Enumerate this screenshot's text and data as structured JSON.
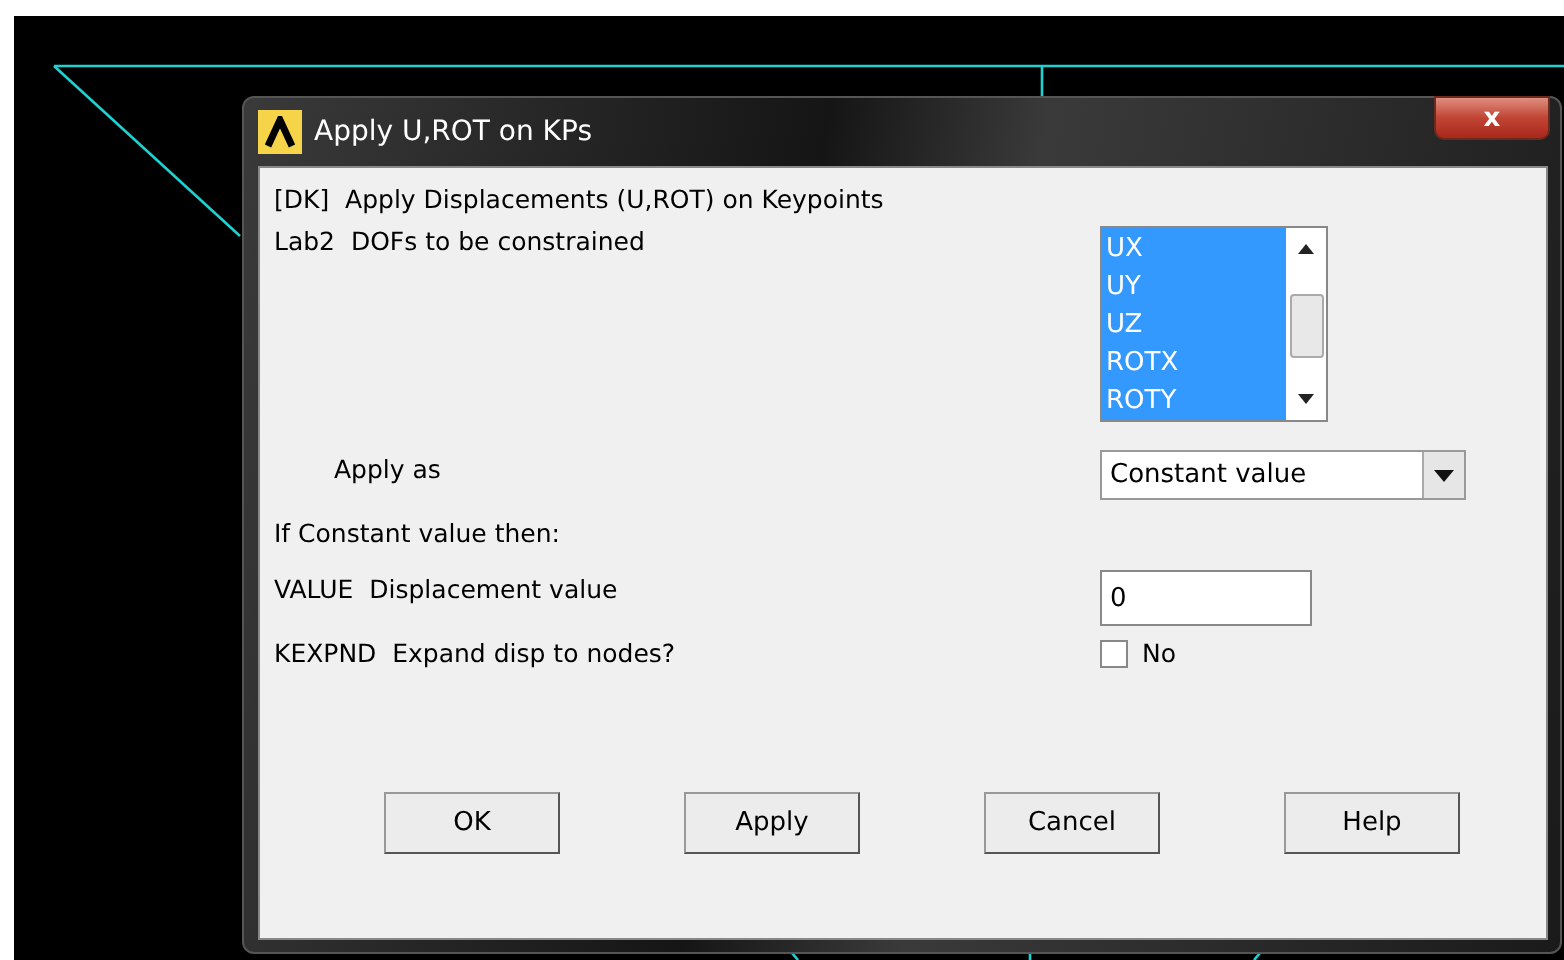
{
  "window": {
    "title": "Apply U,ROT on KPs",
    "close_label": "x"
  },
  "heading": "[DK]  Apply Displacements (U,ROT) on Keypoints",
  "rows": [
    {
      "kind": "listbox",
      "label": "Lab2  DOFs to be constrained",
      "items": [
        {
          "label": "UX",
          "selected": true
        },
        {
          "label": "UY",
          "selected": true
        },
        {
          "label": "UZ",
          "selected": true
        },
        {
          "label": "ROTX",
          "selected": true
        },
        {
          "label": "ROTY",
          "selected": true
        }
      ]
    },
    {
      "kind": "dropdown",
      "label": "Apply as",
      "value": "Constant value"
    },
    {
      "kind": "note",
      "label": "If Constant value then:"
    },
    {
      "kind": "input",
      "label": "VALUE  Displacement value",
      "value": "0"
    },
    {
      "kind": "checkbox",
      "label": "KEXPND  Expand disp to nodes?",
      "checked": false,
      "text": "No"
    }
  ],
  "buttons": [
    "OK",
    "Apply",
    "Cancel",
    "Help"
  ]
}
